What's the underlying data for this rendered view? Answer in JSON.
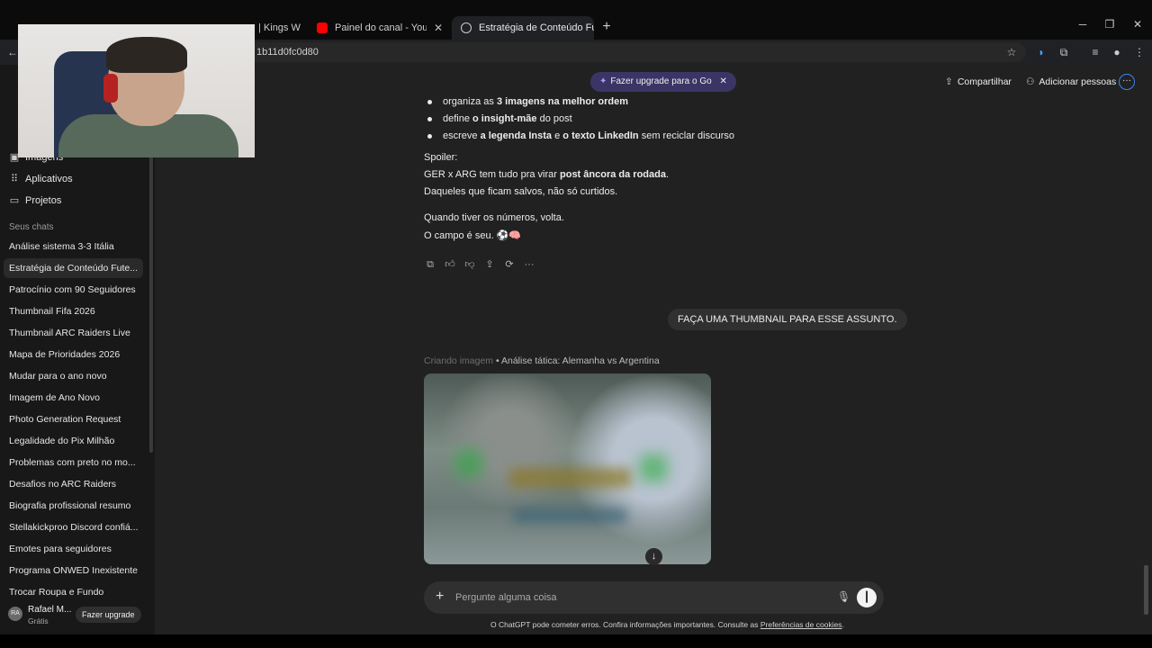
{
  "browser": {
    "tabs": [
      {
        "title": "Painel do canal - YouTube Studio"
      },
      {
        "title": "Estratégia de Conteúdo Futebol"
      }
    ],
    "partial_tab_text": "| Kings W",
    "url_fragment": "1b11d0fc0d80"
  },
  "header": {
    "upgrade_pill": "Fazer upgrade para o Go",
    "share": "Compartilhar",
    "add_people": "Adicionar pessoas"
  },
  "sidebar": {
    "items": [
      {
        "label": "Imagens",
        "icon": "image-icon"
      },
      {
        "label": "Aplicativos",
        "icon": "apps-icon"
      },
      {
        "label": "Projetos",
        "icon": "folder-icon"
      }
    ],
    "section_title": "Seus chats",
    "chats": [
      "Análise sistema 3-3 Itália",
      "Estratégia de Conteúdo Fute...",
      "Patrocínio com 90 Seguidores",
      "Thumbnail Fifa 2026",
      "Thumbnail ARC Raiders Live",
      "Mapa de Prioridades 2026",
      "Mudar para o ano novo",
      "Imagem de Ano Novo",
      "Photo Generation Request",
      "Legalidade do Pix Milhão",
      "Problemas com preto no mo...",
      "Desafios no ARC Raiders",
      "Biografia profissional resumo",
      "Stellakickproo Discord confiá...",
      "Emotes para seguidores",
      "Programa ONWED Inexistente",
      "Trocar Roupa e Fundo"
    ],
    "active_chat_index": 1,
    "user": {
      "initials": "RA",
      "name": "Rafael M...",
      "plan": "Grátis",
      "upgrade": "Fazer upgrade"
    }
  },
  "conversation": {
    "bullets": [
      {
        "pre": "organiza as ",
        "bold": "3 imagens na melhor ordem",
        "post": ""
      },
      {
        "pre": "define ",
        "bold": "o insight-mãe",
        "post": " do post"
      },
      {
        "pre": "escreve ",
        "bold": "a legenda Insta",
        "mid": " e ",
        "bold2": "o texto LinkedIn",
        "post": " sem reciclar discurso"
      }
    ],
    "spoiler_label": "Spoiler:",
    "spoiler_line1_pre": "GER x ARG tem tudo pra virar ",
    "spoiler_line1_bold": "post âncora da rodada",
    "spoiler_line1_post": ".",
    "spoiler_line2": "Daqueles que ficam salvos, não só curtidos.",
    "closing_line1": "Quando tiver os números, volta.",
    "closing_line2": "O campo é seu. ⚽🧠",
    "user_message": "FAÇA UMA THUMBNAIL PARA ESSE ASSUNTO.",
    "creating_label": "Criando imagem",
    "creating_title": " • Análise tática: Alemanha vs Argentina"
  },
  "composer": {
    "placeholder": "Pergunte alguma coisa"
  },
  "footer": {
    "disclaimer": "O ChatGPT pode cometer erros. Confira informações importantes. Consulte as ",
    "link": "Preferências de cookies",
    "end": "."
  }
}
